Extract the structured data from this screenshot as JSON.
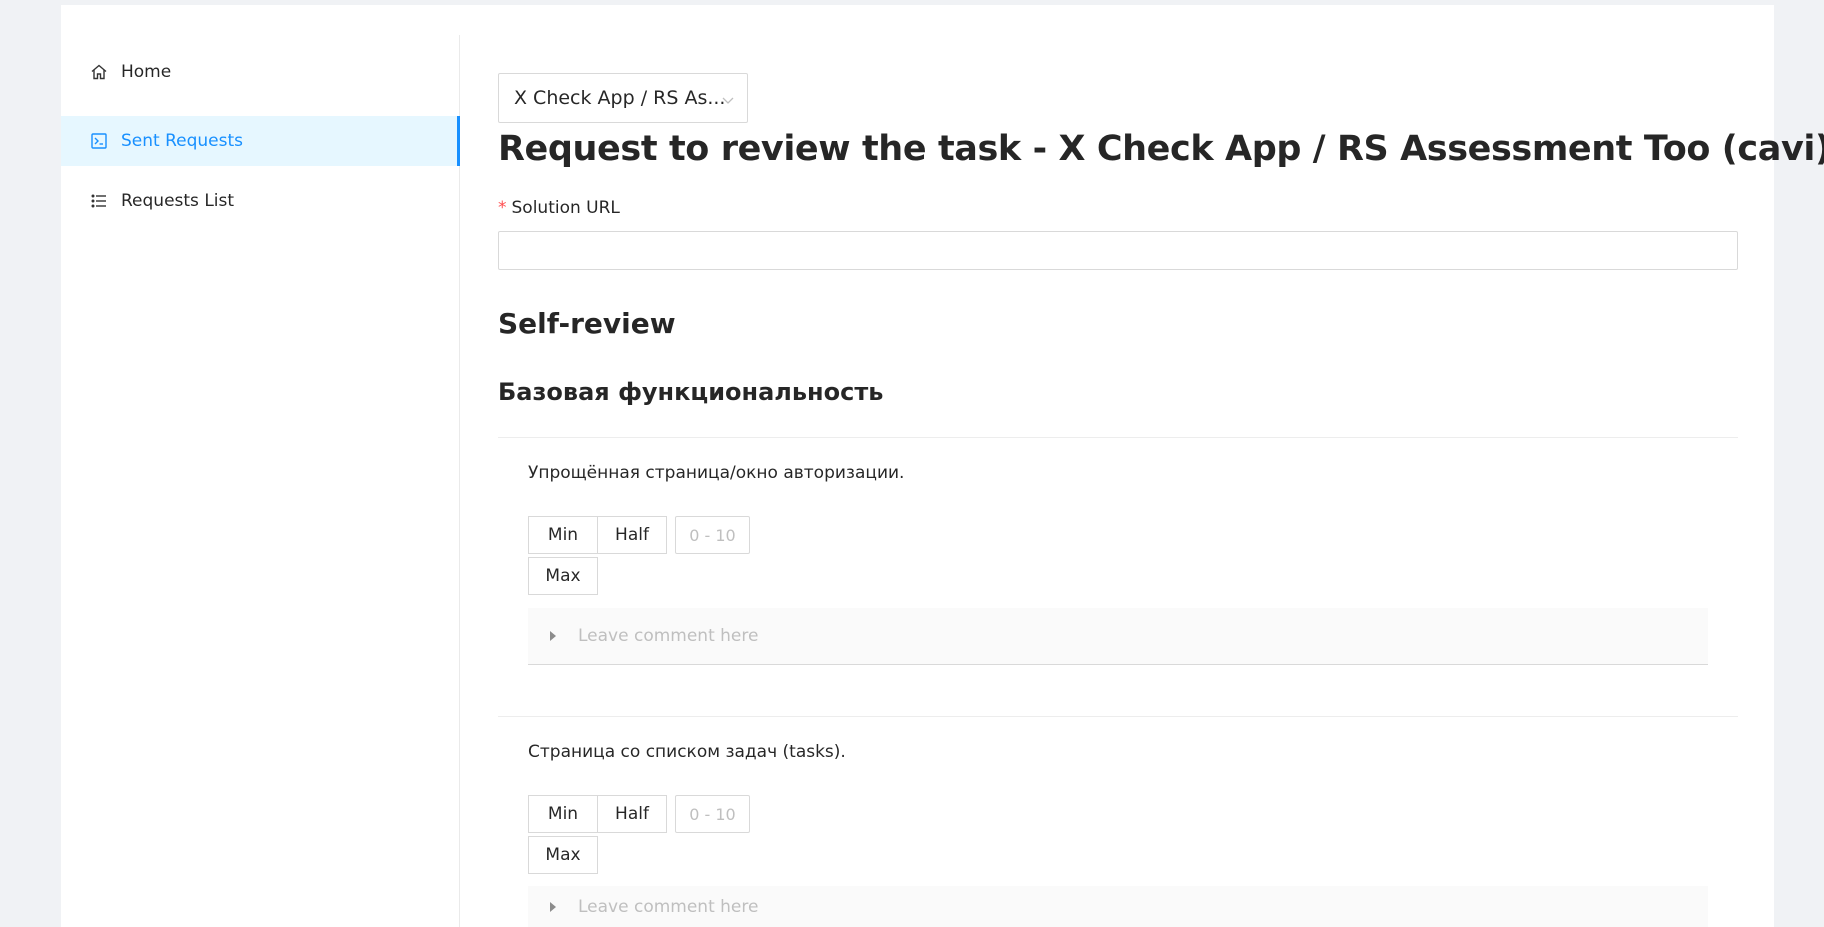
{
  "sidebar": {
    "items": [
      {
        "label": "Home",
        "icon": "home-icon",
        "active": false
      },
      {
        "label": "Sent Requests",
        "icon": "terminal-icon",
        "active": true
      },
      {
        "label": "Requests List",
        "icon": "list-icon",
        "active": false
      }
    ]
  },
  "task_select": {
    "value": "X Check App / RS As..."
  },
  "page": {
    "title": "Request to review the task - X Check App / RS Assessment Too (cavi)"
  },
  "form": {
    "solution_url_label": "Solution URL",
    "required_mark": "*",
    "solution_url_value": ""
  },
  "self_review": {
    "heading": "Self-review"
  },
  "section": {
    "heading": "Базовая функциональность"
  },
  "tasks": [
    {
      "title": "Упрощённая страница/окно авторизации.",
      "min_label": "Min",
      "half_label": "Half",
      "max_label": "Max",
      "score_placeholder": "0 - 10",
      "comment_placeholder": "Leave comment here"
    },
    {
      "title": "Страница со списком задач (tasks).",
      "min_label": "Min",
      "half_label": "Half",
      "max_label": "Max",
      "score_placeholder": "0 - 10",
      "comment_placeholder": "Leave comment here"
    }
  ],
  "colors": {
    "accent": "#1890ff",
    "active_bg": "#e6f7ff",
    "required": "#ff4d4f",
    "page_bg": "#f0f2f5"
  }
}
